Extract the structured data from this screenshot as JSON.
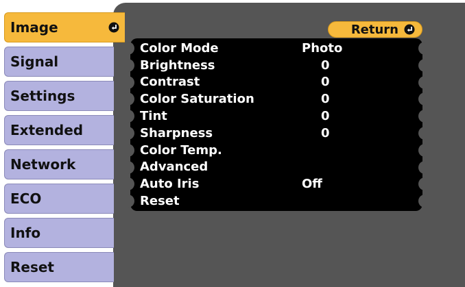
{
  "tabs": [
    {
      "label": "Image",
      "active": true
    },
    {
      "label": "Signal",
      "active": false
    },
    {
      "label": "Settings",
      "active": false
    },
    {
      "label": "Extended",
      "active": false
    },
    {
      "label": "Network",
      "active": false
    },
    {
      "label": "ECO",
      "active": false
    },
    {
      "label": "Info",
      "active": false
    },
    {
      "label": "Reset",
      "active": false
    }
  ],
  "return_button": {
    "label": "Return",
    "icon": "enter-icon"
  },
  "menu": {
    "rows": [
      {
        "label": "Color Mode",
        "value": "Photo"
      },
      {
        "label": "Brightness",
        "value": "0"
      },
      {
        "label": "Contrast",
        "value": "0"
      },
      {
        "label": "Color Saturation",
        "value": "0"
      },
      {
        "label": "Tint",
        "value": "0"
      },
      {
        "label": "Sharpness",
        "value": "0"
      },
      {
        "label": "Color Temp.",
        "value": ""
      },
      {
        "label": "Advanced",
        "value": ""
      },
      {
        "label": "Auto Iris",
        "value": "Off"
      },
      {
        "label": "Reset",
        "value": ""
      }
    ]
  },
  "colors": {
    "panel": "#555555",
    "menu_bg": "#000000",
    "tab_bg": "#b3b2df",
    "tab_active_bg": "#f6b93c"
  }
}
